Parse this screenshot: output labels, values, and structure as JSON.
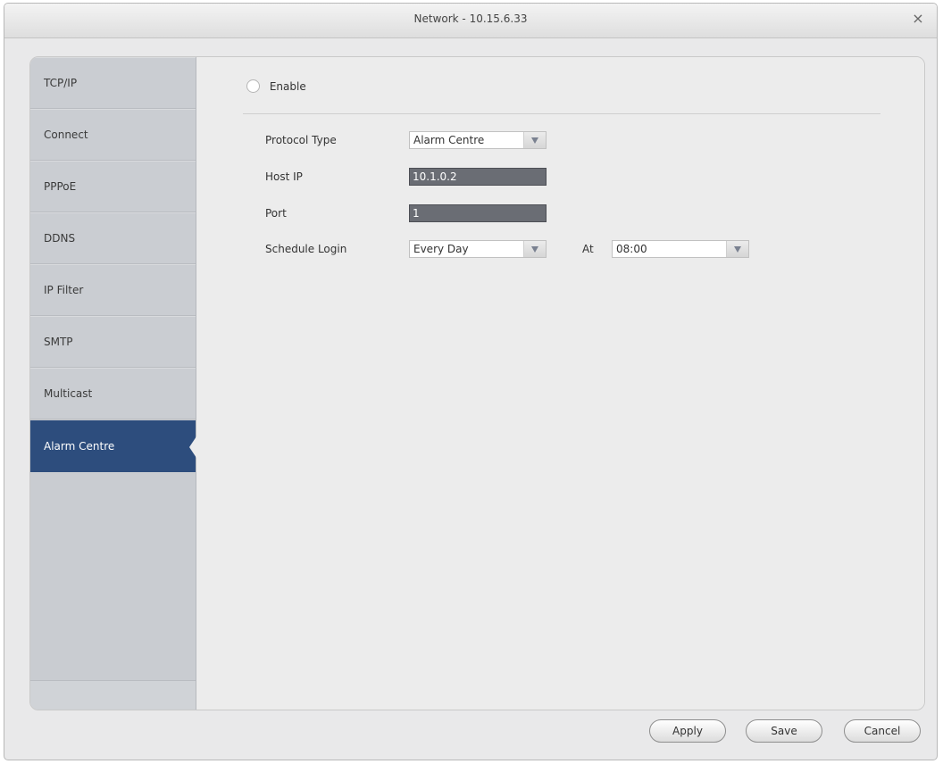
{
  "window": {
    "title": "Network - 10.15.6.33",
    "close_glyph": "×"
  },
  "sidebar": {
    "items": [
      {
        "label": "TCP/IP"
      },
      {
        "label": "Connect"
      },
      {
        "label": "PPPoE"
      },
      {
        "label": "DDNS"
      },
      {
        "label": "IP Filter"
      },
      {
        "label": "SMTP"
      },
      {
        "label": "Multicast"
      },
      {
        "label": "Alarm Centre",
        "active": true
      }
    ]
  },
  "form": {
    "enable_label": "Enable",
    "enable_checked": false,
    "protocol_type_label": "Protocol Type",
    "protocol_type_value": "Alarm Centre",
    "host_ip_label": "Host IP",
    "host_ip_value": "10.1.0.2",
    "port_label": "Port",
    "port_value": "1",
    "schedule_login_label": "Schedule Login",
    "schedule_login_value": "Every Day",
    "at_label": "At",
    "at_value": "08:00"
  },
  "buttons": {
    "apply": "Apply",
    "save": "Save",
    "cancel": "Cancel"
  },
  "colors": {
    "active_item": "#2d4d7d",
    "sidebar": "#cacdd2",
    "input_bg": "#6a6d74"
  }
}
